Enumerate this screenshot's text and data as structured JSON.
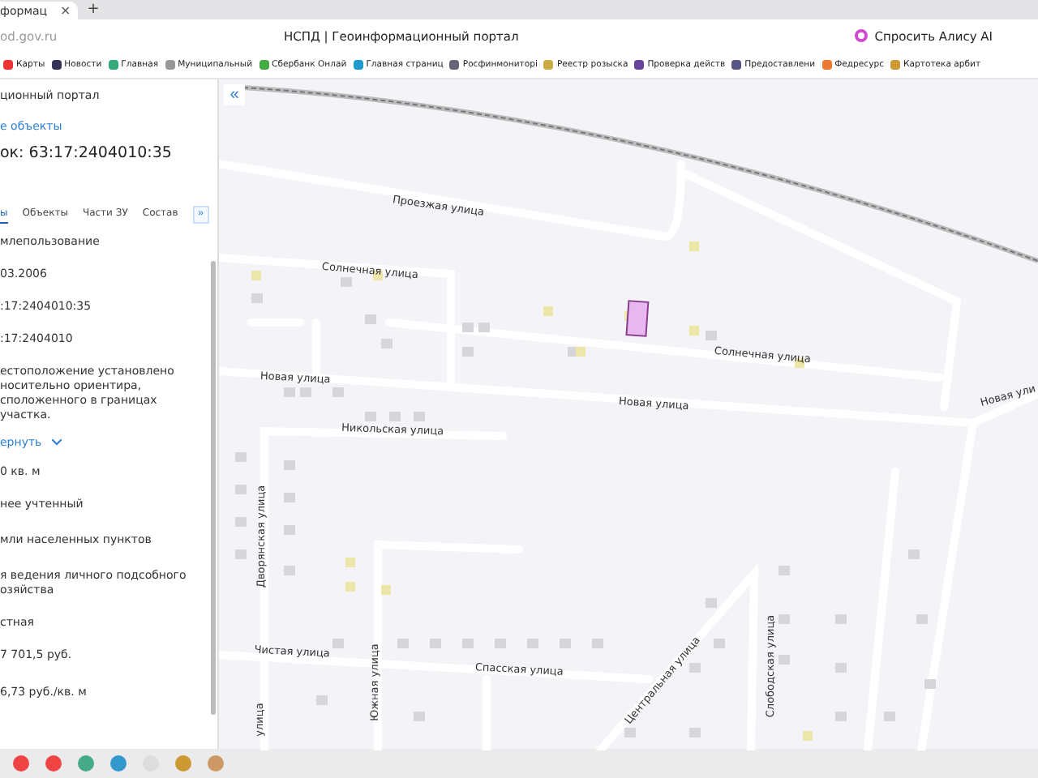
{
  "browser": {
    "tabs": [
      {
        "label": "формац",
        "selected": true,
        "close": "×"
      }
    ],
    "new_tab": "+",
    "address": "od.gov.ru",
    "page_title": "НСПД | Геоинформационный портал",
    "alice": "Спросить Алису AI",
    "bookmarks": [
      "Карты",
      "Новости",
      "Главная",
      "Муниципальный",
      "Сбербанк Онлай",
      "Главная страниц",
      "Росфинмониторі",
      "Реестр розыска",
      "Проверка действ",
      "Предоставлени",
      "Федресурс",
      "Картотека арбит"
    ]
  },
  "panel": {
    "portal": "ционный портал",
    "link": "е объекты",
    "title": "ок: 63:17:2404010:35",
    "tabs": [
      {
        "label": "ы",
        "selected": true
      },
      {
        "label": "Объекты",
        "selected": false
      },
      {
        "label": "Части ЗУ",
        "selected": false
      },
      {
        "label": "Состав",
        "selected": false
      }
    ],
    "more": "»",
    "fields": [
      {
        "kind": "text",
        "value": "млепользование"
      },
      {
        "kind": "text",
        "value": "03.2006"
      },
      {
        "kind": "text",
        "value": ":17:2404010:35"
      },
      {
        "kind": "text",
        "value": ":17:2404010"
      },
      {
        "kind": "text",
        "value": "естоположение установлено носительно ориентира, сположенного в границах участка."
      },
      {
        "kind": "toggle",
        "value": "ернуть"
      },
      {
        "kind": "text",
        "value": "0 кв. м"
      },
      {
        "kind": "text",
        "value": "нее учтенный"
      },
      {
        "kind": "text",
        "value": "мли населенных пунктов"
      },
      {
        "kind": "text",
        "value": "я ведения личного подсобного озяйства"
      },
      {
        "kind": "text",
        "value": "стная"
      },
      {
        "kind": "text",
        "value": "7 701,5 руб."
      },
      {
        "kind": "text",
        "value": "6,73 руб./кв. м"
      }
    ]
  },
  "map": {
    "collapse": "«",
    "streets": [
      "Проезжая улица",
      "Солнечная улица",
      "Солнечная улица",
      "Новая улица",
      "Новая улица",
      "Новая ули",
      "Никольская улица",
      "Дворянская улица",
      "Чистая улица",
      "Спасская улица",
      "Южная улица",
      "улица",
      "Центральная улица",
      "Слободская улица"
    ]
  }
}
